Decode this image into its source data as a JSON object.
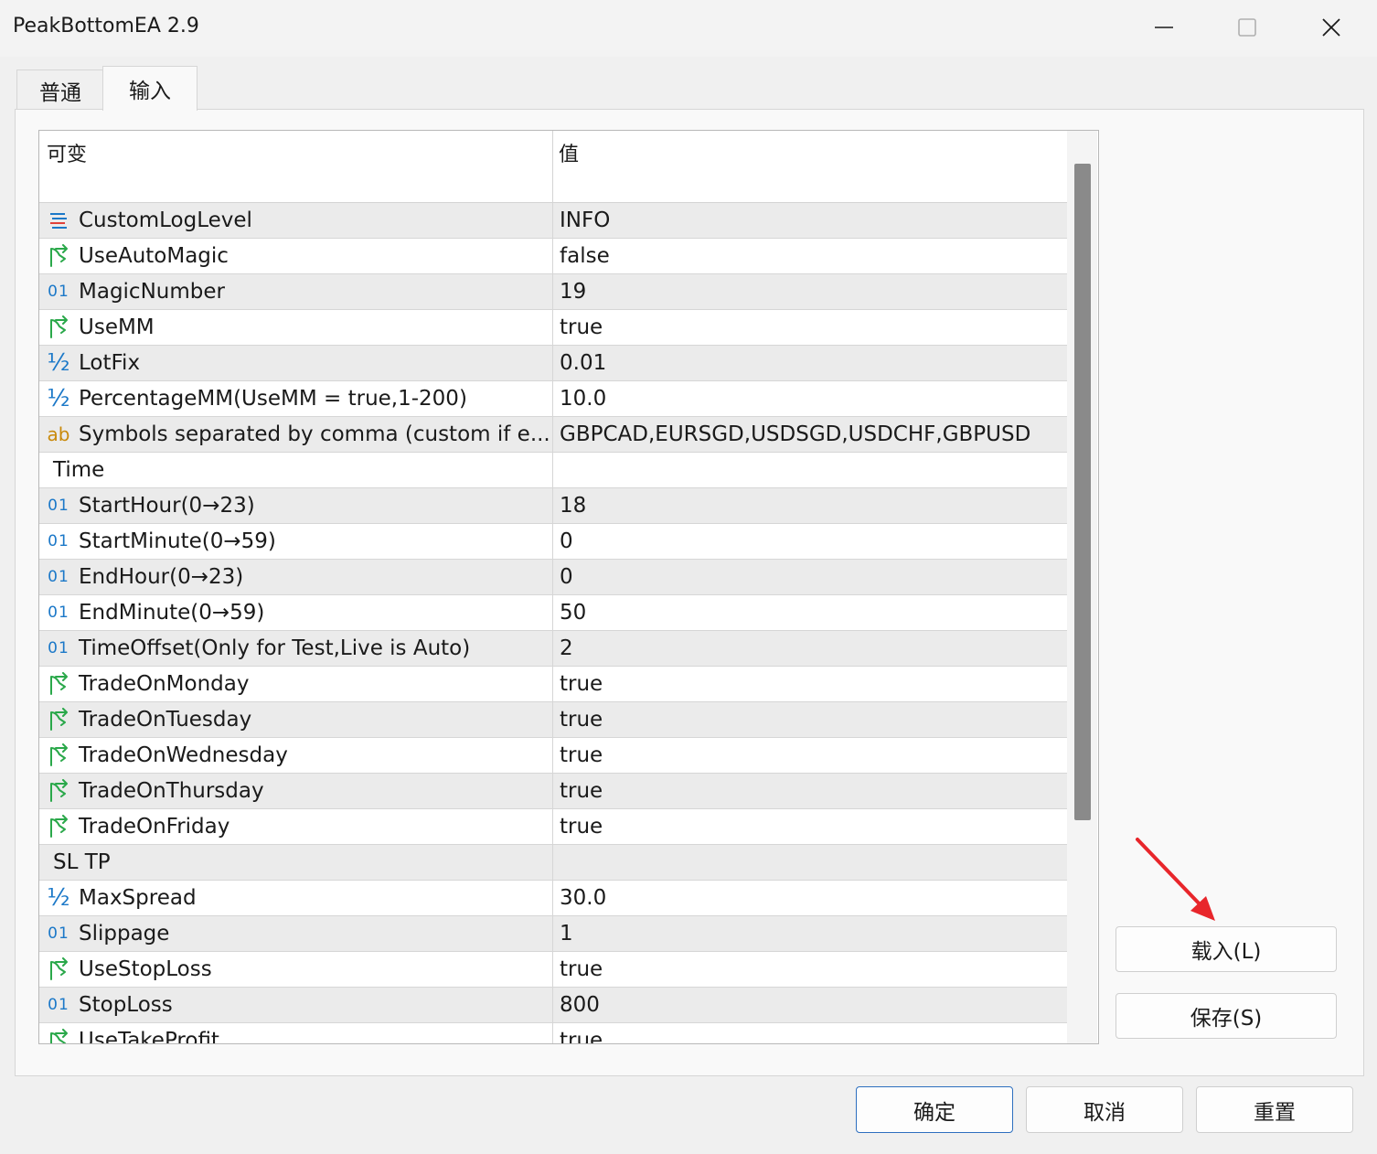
{
  "window": {
    "title": "PeakBottomEA 2.9",
    "controls": [
      "minimize-icon",
      "maximize-icon",
      "close-icon"
    ]
  },
  "tabs": [
    {
      "label": "普通",
      "active": false
    },
    {
      "label": "输入",
      "active": true
    }
  ],
  "grid": {
    "columns": [
      "可变",
      "值"
    ],
    "rows": [
      {
        "icon": "enum-icon",
        "name": "CustomLogLevel",
        "value": "INFO"
      },
      {
        "icon": "bool-icon",
        "name": "UseAutoMagic",
        "value": "false"
      },
      {
        "icon": "int-icon",
        "name": "MagicNumber",
        "value": "19"
      },
      {
        "icon": "bool-icon",
        "name": "UseMM",
        "value": "true"
      },
      {
        "icon": "double-icon",
        "name": "LotFix",
        "value": "0.01"
      },
      {
        "icon": "double-icon",
        "name": "PercentageMM(UseMM = true,1-200)",
        "value": "10.0"
      },
      {
        "icon": "string-icon",
        "name": "Symbols separated by comma (custom if e...",
        "value": "GBPCAD,EURSGD,USDSGD,USDCHF,GBPUSD"
      },
      {
        "icon": "none",
        "name": "Time",
        "value": ""
      },
      {
        "icon": "int-icon",
        "name": "StartHour(0→23)",
        "value": "18"
      },
      {
        "icon": "int-icon",
        "name": "StartMinute(0→59)",
        "value": "0"
      },
      {
        "icon": "int-icon",
        "name": "EndHour(0→23)",
        "value": "0"
      },
      {
        "icon": "int-icon",
        "name": "EndMinute(0→59)",
        "value": "50"
      },
      {
        "icon": "int-icon",
        "name": "TimeOffset(Only for Test,Live is Auto)",
        "value": "2"
      },
      {
        "icon": "bool-icon",
        "name": "TradeOnMonday",
        "value": "true"
      },
      {
        "icon": "bool-icon",
        "name": "TradeOnTuesday",
        "value": "true"
      },
      {
        "icon": "bool-icon",
        "name": "TradeOnWednesday",
        "value": "true"
      },
      {
        "icon": "bool-icon",
        "name": "TradeOnThursday",
        "value": "true"
      },
      {
        "icon": "bool-icon",
        "name": "TradeOnFriday",
        "value": "true"
      },
      {
        "icon": "none",
        "name": "SL TP",
        "value": ""
      },
      {
        "icon": "double-icon",
        "name": "MaxSpread",
        "value": "30.0"
      },
      {
        "icon": "int-icon",
        "name": "Slippage",
        "value": "1"
      },
      {
        "icon": "bool-icon",
        "name": "UseStopLoss",
        "value": "true"
      },
      {
        "icon": "int-icon",
        "name": "StopLoss",
        "value": "800"
      },
      {
        "icon": "bool-icon",
        "name": "UseTakeProfit",
        "value": "true"
      }
    ]
  },
  "icon_glyphs": {
    "int": "01",
    "double": "½",
    "string": "ab"
  },
  "side_buttons": {
    "load": "载入(L)",
    "save": "保存(S)"
  },
  "footer_buttons": {
    "ok": "确定",
    "cancel": "取消",
    "reset": "重置"
  },
  "colors": {
    "int_icon": "#1b78c8",
    "bool_icon": "#2aa84a",
    "string_icon": "#c98a0b",
    "enum_icon_top": "#1b78c8",
    "enum_icon_bottom": "#e0413a",
    "annotation_arrow": "#e8262b",
    "ok_border": "#2d6fbf"
  }
}
